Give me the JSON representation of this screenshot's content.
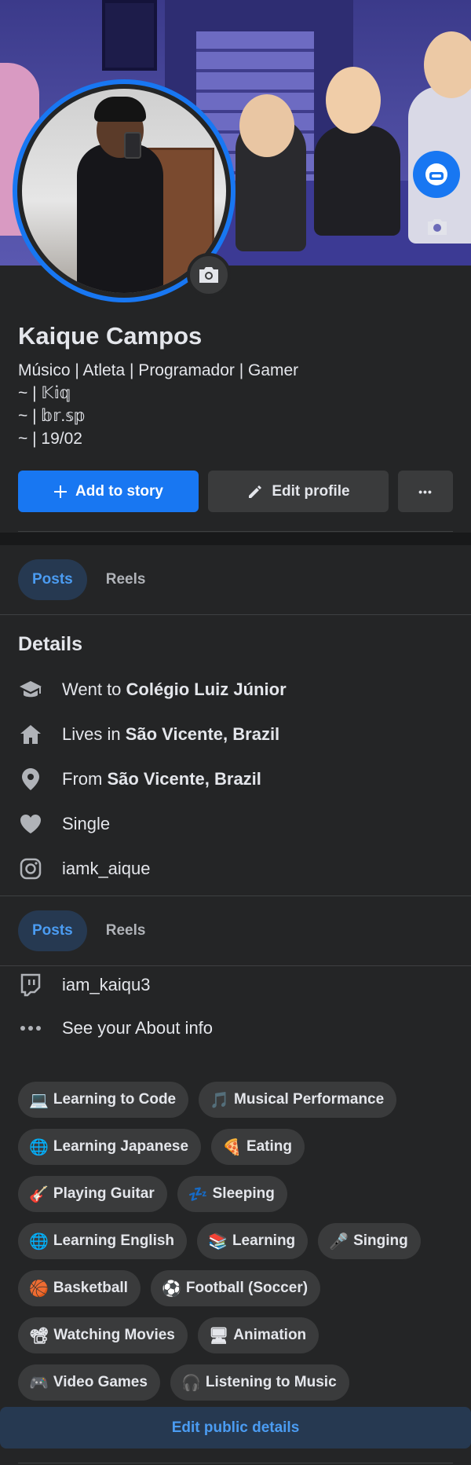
{
  "profile": {
    "name": "Kaique Campos",
    "bio_lines": [
      "Músico | Atleta | Programador | Gamer",
      "~ | 𝕂𝕚𝕢",
      "~ | 𝕓𝕣.𝕤𝕡",
      "~ | 19/02"
    ]
  },
  "actions": {
    "add_story": "Add to story",
    "edit_profile": "Edit profile",
    "more": "•••"
  },
  "tabs": [
    {
      "label": "Posts",
      "active": true
    },
    {
      "label": "Reels",
      "active": false
    }
  ],
  "details": {
    "title": "Details",
    "items": [
      {
        "icon": "graduation-cap-icon",
        "prefix": "Went to ",
        "value": "Colégio Luiz Júnior"
      },
      {
        "icon": "home-icon",
        "prefix": "Lives in ",
        "value": "São Vicente, Brazil"
      },
      {
        "icon": "location-pin-icon",
        "prefix": "From ",
        "value": "São Vicente, Brazil"
      },
      {
        "icon": "heart-icon",
        "prefix": "Single",
        "value": ""
      },
      {
        "icon": "instagram-icon",
        "prefix": "iamk_aique",
        "value": ""
      },
      {
        "icon": "twitch-icon",
        "prefix": "iam_kaiqu3",
        "value": ""
      },
      {
        "icon": "more-dots-icon",
        "prefix": "See your About info",
        "value": ""
      }
    ]
  },
  "hobbies": [
    [
      {
        "emoji": "💻",
        "label": "Learning to Code"
      },
      {
        "emoji": "🎵",
        "label": "Musical Performance"
      }
    ],
    [
      {
        "emoji": "🌐",
        "label": "Learning Japanese"
      },
      {
        "emoji": "🍕",
        "label": "Eating"
      }
    ],
    [
      {
        "emoji": "🎸",
        "label": "Playing Guitar"
      },
      {
        "emoji": "💤",
        "label": "Sleeping"
      }
    ],
    [
      {
        "emoji": "🌐",
        "label": "Learning English"
      },
      {
        "emoji": "📚",
        "label": "Learning"
      },
      {
        "emoji": "🎤",
        "label": "Singing"
      }
    ],
    [
      {
        "emoji": "🏀",
        "label": "Basketball"
      },
      {
        "emoji": "⚽",
        "label": "Football (Soccer)"
      }
    ],
    [
      {
        "emoji": "📽",
        "label": "Watching Movies"
      },
      {
        "emoji": "🖥",
        "label": "Animation"
      }
    ],
    [
      {
        "emoji": "🎮",
        "label": "Video Games"
      },
      {
        "emoji": "🎧",
        "label": "Listening to Music"
      }
    ]
  ],
  "footer": {
    "edit_public_details": "Edit public details"
  },
  "colors": {
    "accent": "#1877f2",
    "background": "#242526",
    "chip": "#3a3b3c",
    "tab_active_bg": "#263951",
    "tab_active_text": "#4b9cf2"
  }
}
